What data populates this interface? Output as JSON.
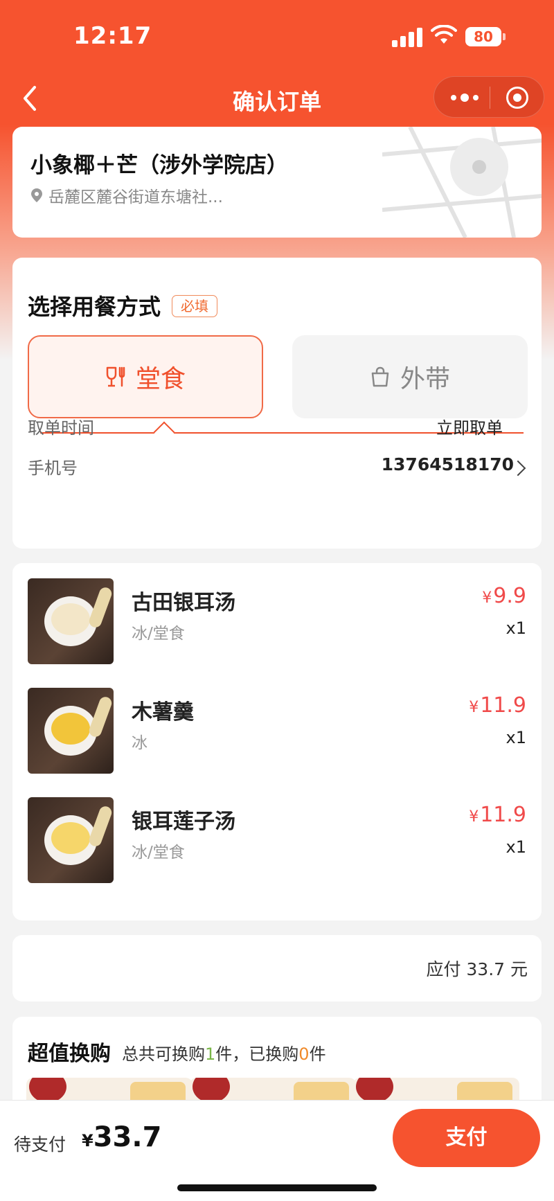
{
  "status_bar": {
    "time": "12:17",
    "battery": "80"
  },
  "nav": {
    "title": "确认订单",
    "back_icon": "back-icon",
    "more_icon": "more-dots-icon",
    "close_icon": "target-icon"
  },
  "store": {
    "name": "小象椰＋芒（涉外学院店）",
    "address": "岳麓区麓谷街道东塘社...",
    "location_icon": "location-pin-icon"
  },
  "dining": {
    "title": "选择用餐方式",
    "required_badge": "必填",
    "options": [
      {
        "label": "堂食",
        "icon": "utensils-icon",
        "selected": true
      },
      {
        "label": "外带",
        "icon": "bag-icon",
        "selected": false
      }
    ],
    "pickup_time_label": "取单时间",
    "pickup_time_value": "立即取单",
    "phone_label": "手机号",
    "phone_value": "13764518170"
  },
  "items": [
    {
      "name": "古田银耳汤",
      "spec": "冰/堂食",
      "currency": "¥",
      "price": "9.9",
      "qty": "x1",
      "soup_color": "#f3e6c8"
    },
    {
      "name": "木薯羹",
      "spec": "冰",
      "currency": "¥",
      "price": "11.9",
      "qty": "x1",
      "soup_color": "#f2c53a"
    },
    {
      "name": "银耳莲子汤",
      "spec": "冰/堂食",
      "currency": "¥",
      "price": "11.9",
      "qty": "x1",
      "soup_color": "#f6d66a"
    }
  ],
  "total": {
    "text": "应付 33.7 元"
  },
  "exchange": {
    "title": "超值换购",
    "desc_prefix": "总共可换购",
    "available": "1",
    "desc_mid": "件，已换购",
    "exchanged": "0",
    "desc_suffix": "件"
  },
  "bottom": {
    "pay_label": "待支付",
    "currency": "¥",
    "amount": "33.7",
    "pay_button": "支付"
  },
  "colors": {
    "brand": "#f6532f",
    "price": "#f04a4a",
    "accent_green": "#7ab648",
    "accent_orange": "#f08a2a"
  }
}
